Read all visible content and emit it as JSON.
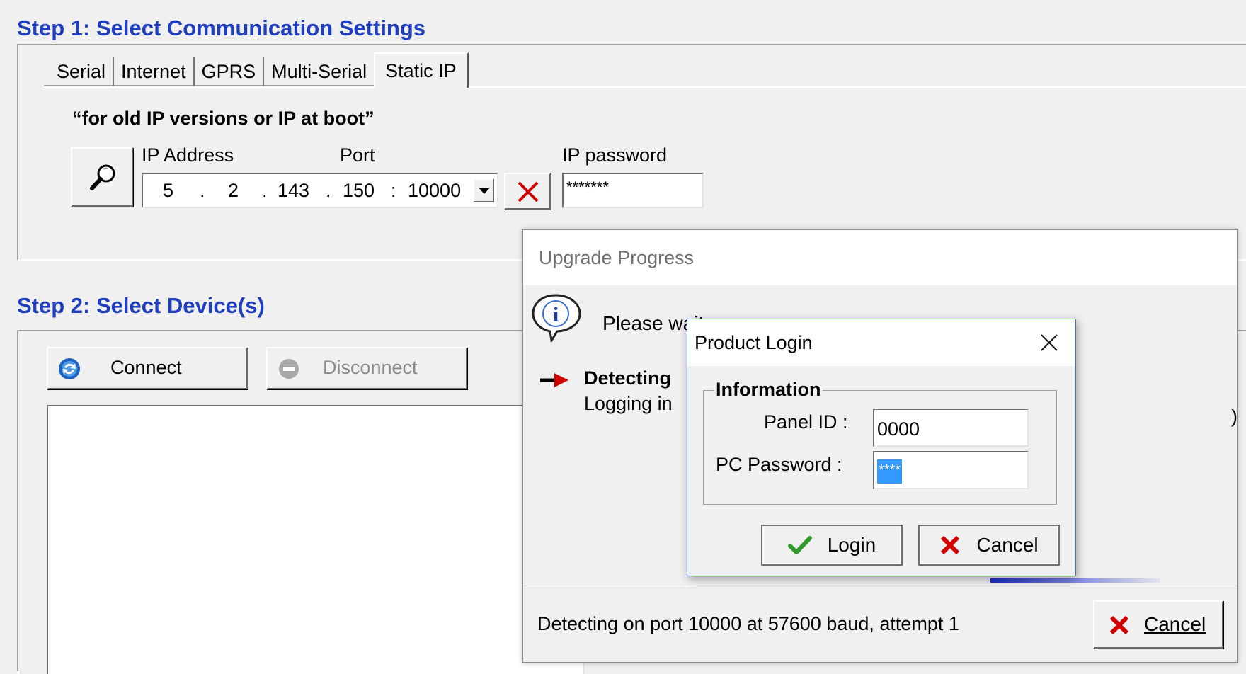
{
  "step1": {
    "title": "Step 1: Select Communication Settings",
    "tabs": [
      "Serial",
      "Internet",
      "GPRS",
      "Multi-Serial",
      "Static IP"
    ],
    "active_tab": "Static IP",
    "note": "“for old IP versions or IP at boot”",
    "ip_address_label": "IP Address",
    "port_label": "Port",
    "ip_password_label": "IP password",
    "ip_octets": [
      "5",
      "2",
      "143",
      "150"
    ],
    "port_value": "10000",
    "ip_password_value": "*******"
  },
  "step2": {
    "title": "Step 2: Select Device(s)",
    "connect_label": "Connect",
    "disconnect_label": "Disconnect"
  },
  "upgrade_dialog": {
    "title": "Upgrade Progress",
    "message": "Please wait",
    "step_heading": "Detecting",
    "step_detail": "Logging in",
    "status": "Detecting on port 10000 at 57600 baud, attempt 1",
    "cancel_label": "Cancel"
  },
  "login_dialog": {
    "title": "Product Login",
    "group_label": "Information",
    "panel_id_label": "Panel ID :",
    "panel_id_value": "0000",
    "pc_password_label": "PC Password :",
    "pc_password_value": "****",
    "login_label": "Login",
    "cancel_label": "Cancel"
  },
  "colors": {
    "heading_blue": "#1f3fbf",
    "cancel_red": "#d00000",
    "check_green": "#2e9a2e",
    "selection_blue": "#3399ff"
  }
}
